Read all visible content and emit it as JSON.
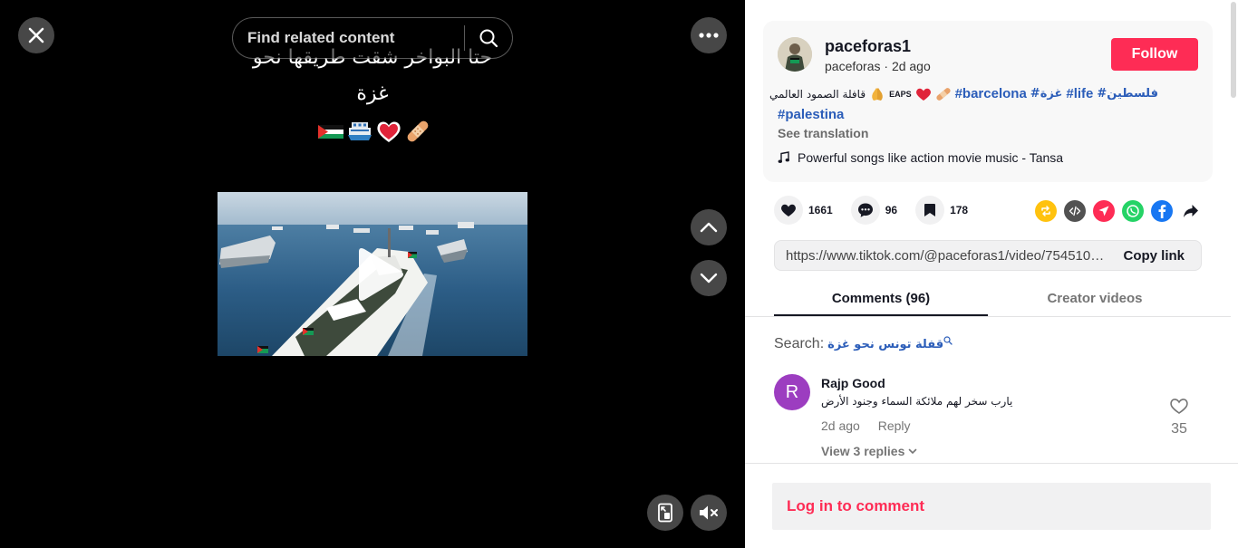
{
  "video": {
    "search_placeholder": "Find related content",
    "caption_line1": "حتا البواخر شقت طريقها نحو",
    "caption_line2": "غزة",
    "emojis": [
      "palestine-flag",
      "ship",
      "heart",
      "bandage"
    ]
  },
  "post": {
    "username": "paceforas1",
    "handle": "paceforas",
    "posted": "2d ago",
    "follow_label": "Follow",
    "description_text": "قافلة الصمود العالمي",
    "description_badge": "EAPS",
    "hashtags": [
      "#barcelona",
      "#غزة",
      "#life",
      "#فلسطين",
      "#palestina"
    ],
    "see_translation": "See translation",
    "music": "Powerful songs like action movie music - Tansa"
  },
  "actions": {
    "likes": "1661",
    "comments": "96",
    "saves": "178"
  },
  "share": {
    "link": "https://www.tiktok.com/@paceforas1/video/7545101650000000000",
    "copy_label": "Copy link",
    "colors": {
      "repost": "#ffc20e",
      "embed": "#525252",
      "send": "#fe2c55",
      "whatsapp": "#25d366",
      "facebook": "#1877f2"
    }
  },
  "tabs": {
    "comments": "Comments (96)",
    "creator_videos": "Creator videos"
  },
  "search": {
    "label": "Search:",
    "term": "قفلة تونس نحو غزة"
  },
  "comment": {
    "avatar_letter": "R",
    "name": "Rajp Good",
    "text": "يارب سخر لهم ملائكة السماء وجنود الأرض",
    "time": "2d ago",
    "reply_label": "Reply",
    "replies_label": "View 3 replies",
    "likes": "35"
  },
  "login": {
    "label": "Log in to comment"
  },
  "colors": {
    "accent": "#fe2c55",
    "hashtag": "#2b5db9",
    "avatar_bg": "#9c3dc0"
  }
}
